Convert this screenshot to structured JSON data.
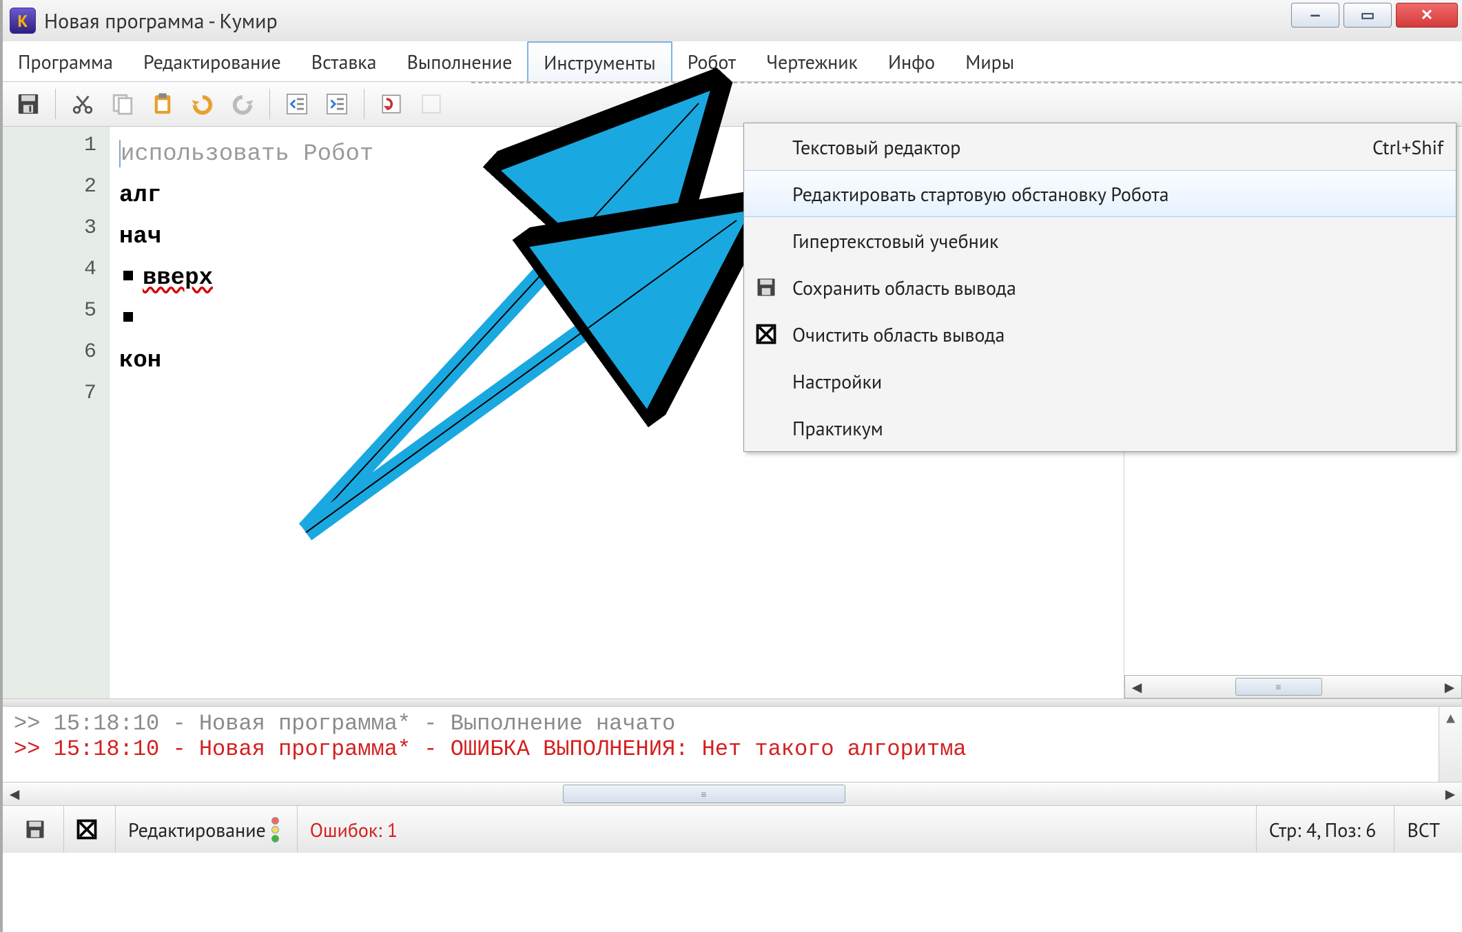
{
  "window": {
    "title": "Новая программа - Кумир",
    "app_icon_letter": "К"
  },
  "menubar": {
    "items": [
      "Программа",
      "Редактирование",
      "Вставка",
      "Выполнение",
      "Инструменты",
      "Робот",
      "Чертежник",
      "Инфо",
      "Миры"
    ],
    "active_index": 4
  },
  "toolbar": {
    "buttons": [
      "save",
      "cut",
      "copy",
      "paste",
      "undo",
      "redo",
      "indent-left",
      "indent-right",
      "run-step",
      "run"
    ]
  },
  "dropdown": {
    "items": [
      {
        "label": "Текстовый редактор",
        "icon": null,
        "shortcut": "Ctrl+Shif"
      },
      {
        "label": "Редактировать стартовую обстановку Робота",
        "icon": null,
        "hovered": true
      },
      {
        "label": "Гипертекстовый учебник",
        "icon": null
      },
      {
        "label": "Сохранить область вывода",
        "icon": "save"
      },
      {
        "label": "Очистить область вывода",
        "icon": "clear"
      },
      {
        "label": "Настройки",
        "icon": null
      },
      {
        "label": "Практикум",
        "icon": null
      }
    ]
  },
  "editor": {
    "gutter": [
      "1",
      "2",
      "3",
      "4",
      "5",
      "6",
      "7"
    ],
    "lines": [
      {
        "tokens": [
          {
            "cls": "caret"
          },
          {
            "cls": "tok-gray",
            "t": "использовать Робот"
          }
        ]
      },
      {
        "tokens": [
          {
            "cls": "tok-kw",
            "t": "алг"
          }
        ]
      },
      {
        "tokens": [
          {
            "cls": "tok-kw",
            "t": "нач"
          }
        ]
      },
      {
        "tokens": [
          {
            "cls": "bullet"
          },
          {
            "cls": "tok-err",
            "t": "вверх"
          }
        ]
      },
      {
        "tokens": [
          {
            "cls": "bullet"
          }
        ]
      },
      {
        "tokens": [
          {
            "cls": "tok-kw",
            "t": "кон"
          }
        ]
      },
      {
        "tokens": []
      }
    ]
  },
  "console": {
    "line1_prefix": ">> 15:18:10 - Новая программа* - Выполнение начато",
    "line2_prefix": ">> 15:18:10 - Новая программа* - ОШИБКА ВЫПОЛНЕНИЯ: Нет такого алгоритма"
  },
  "statusbar": {
    "mode": "Редактирование",
    "errors": "Ошибок: 1",
    "cursor": "Стр: 4, Поз: 6",
    "insert": "ВСТ"
  }
}
